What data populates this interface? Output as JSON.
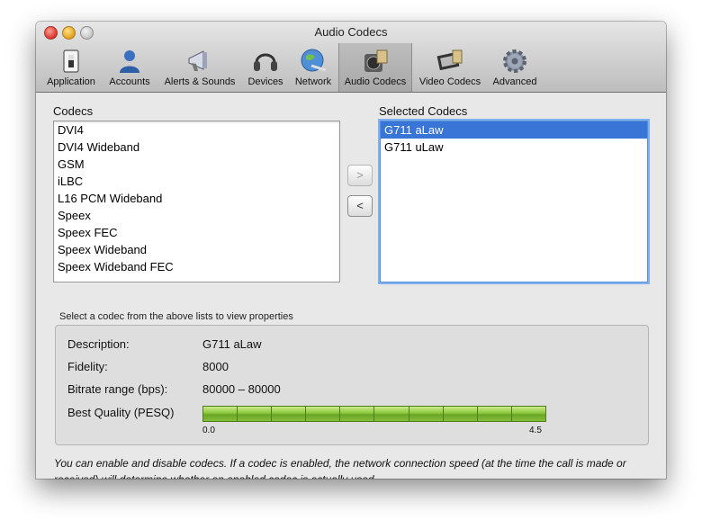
{
  "window": {
    "title": "Audio Codecs"
  },
  "toolbar": {
    "items": [
      {
        "label": "Application",
        "icon": "application-switch-icon"
      },
      {
        "label": "Accounts",
        "icon": "person-icon"
      },
      {
        "label": "Alerts & Sounds",
        "icon": "megaphone-icon"
      },
      {
        "label": "Devices",
        "icon": "headset-icon"
      },
      {
        "label": "Network",
        "icon": "network-globe-icon"
      },
      {
        "label": "Audio Codecs",
        "icon": "speaker-codec-icon"
      },
      {
        "label": "Video Codecs",
        "icon": "film-codec-icon"
      },
      {
        "label": "Advanced",
        "icon": "gear-icon"
      }
    ],
    "selected": "Audio Codecs"
  },
  "codecs": {
    "heading": "Codecs",
    "items": [
      "DVI4",
      "DVI4 Wideband",
      "GSM",
      "iLBC",
      "L16 PCM Wideband",
      "Speex",
      "Speex FEC",
      "Speex Wideband",
      "Speex Wideband FEC"
    ]
  },
  "move_buttons": {
    "add": ">",
    "remove": "<"
  },
  "selected_codecs": {
    "heading": "Selected Codecs",
    "items": [
      "G711 aLaw",
      "G711 uLaw"
    ],
    "selected_index": 0
  },
  "hint": "Select a codec from the above lists to view properties",
  "properties": {
    "description_label": "Description:",
    "description_value": "G711 aLaw",
    "fidelity_label": "Fidelity:",
    "fidelity_value": "8000",
    "bitrate_label": "Bitrate range (bps):",
    "bitrate_value": "80000 – 80000",
    "quality_label": "Best Quality (PESQ)",
    "quality_min": "0.0",
    "quality_max": "4.5",
    "quality_fraction": 1.0,
    "quality_segments": 10
  },
  "footnote": "You can enable and disable codecs. If a codec is enabled, the network connection speed (at the time the call is made or received) will determine whether an enabled codec is actually used.",
  "colors": {
    "selection": "#3875d7",
    "focus_ring": "#7fb0ef",
    "bar_green": "#8dc83d"
  }
}
